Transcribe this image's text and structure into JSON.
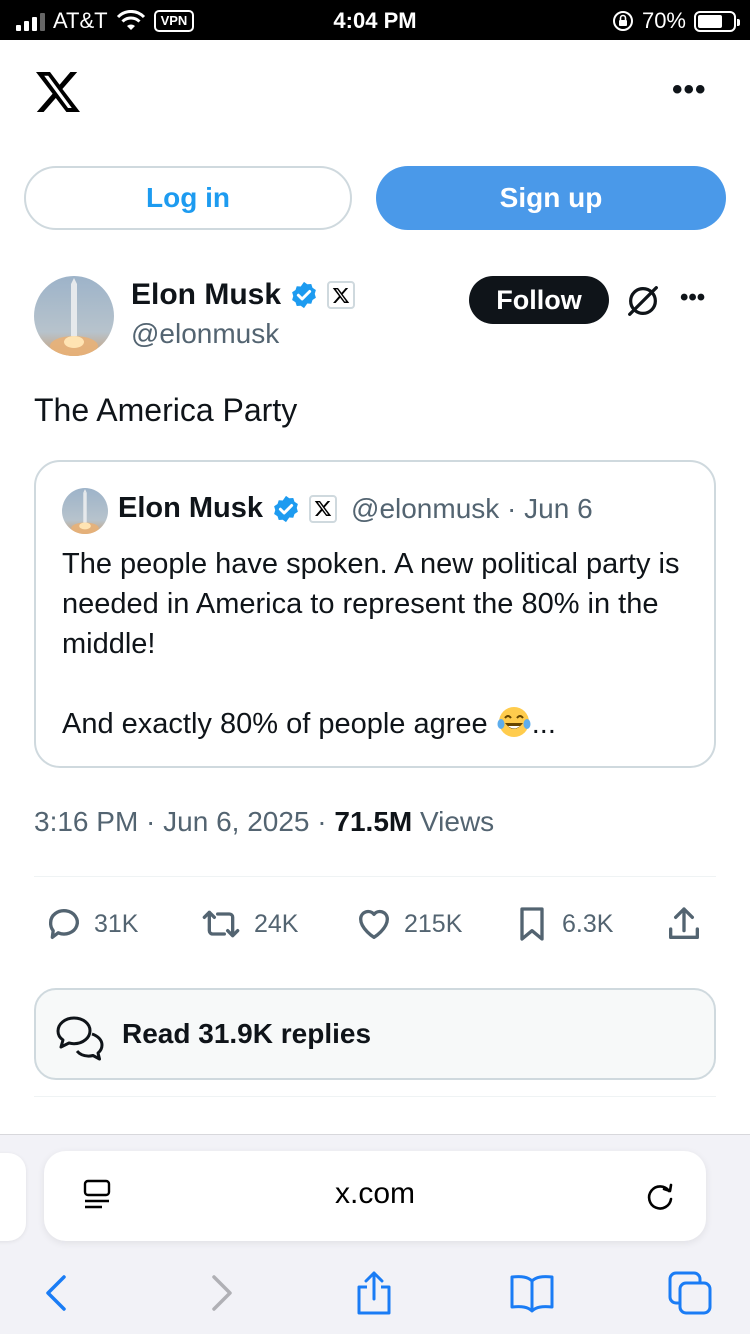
{
  "status_bar": {
    "carrier": "AT&T",
    "vpn_label": "VPN",
    "time": "4:04 PM",
    "battery": "70%",
    "battery_level": 0.7,
    "icons": [
      "signal-icon",
      "wifi-icon",
      "orientation-lock-icon",
      "battery-icon"
    ]
  },
  "header": {
    "logo_icon": "x-logo-icon",
    "more_label": "•••",
    "login_label": "Log in",
    "signup_label": "Sign up"
  },
  "tweet": {
    "author_name": "Elon Musk",
    "author_handle": "@elonmusk",
    "follow_label": "Follow",
    "more_label": "•••",
    "text": "The America Party",
    "quote": {
      "author_name": "Elon Musk",
      "author_handle": "@elonmusk · Jun 6",
      "paragraph_1": "The people have spoken. A new political party is needed in America to represent the 80% in the middle!",
      "paragraph_2": "And exactly 80% of people agree",
      "paragraph_2_suffix": "...",
      "emoji": "laughing-tears-emoji"
    },
    "meta_date": "3:16 PM · Jun 6, 2025 · ",
    "views_count": "71.5M",
    "views_label": " Views",
    "stats": {
      "replies": "31K",
      "reposts": "24K",
      "likes": "215K",
      "bookmarks": "6.3K"
    },
    "read_replies_label": "Read 31.9K replies"
  },
  "browser": {
    "url": "x.com",
    "icons": [
      "reader-icon",
      "reload-icon",
      "back-icon",
      "forward-icon",
      "share-icon",
      "bookmarks-icon",
      "tabs-icon"
    ]
  },
  "colors": {
    "brand_blue": "#1d9bf0",
    "signup_blue": "#4a99e9",
    "verified_blue": "#1d9bf0",
    "safari_blue": "#1a7cf5",
    "text_primary": "#0f1419",
    "text_secondary": "#536471"
  }
}
